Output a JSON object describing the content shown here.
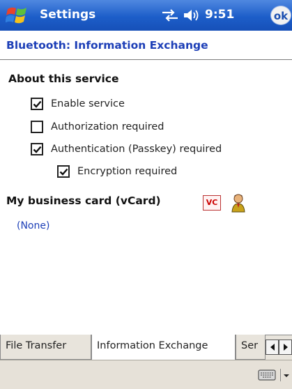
{
  "titlebar": {
    "app_title": "Settings",
    "clock": "9:51",
    "ok_label": "ok",
    "start_icon": "windows-flag-icon",
    "connectivity_icon": "connectivity-icon",
    "volume_icon": "speaker-icon"
  },
  "page": {
    "title": "Bluetooth: Information Exchange",
    "section_title": "About this service",
    "options": [
      {
        "label": "Enable service",
        "checked": true
      },
      {
        "label": "Authorization required",
        "checked": false
      },
      {
        "label": "Authentication (Passkey) required",
        "checked": true
      },
      {
        "label": "Encryption required",
        "checked": true
      }
    ],
    "vcard_title": "My business card (vCard)",
    "vcard_icon_label": "VC",
    "vcard_value": "(None)"
  },
  "tabs": [
    {
      "label": "File Transfer",
      "active": false
    },
    {
      "label": "Information Exchange",
      "active": true
    },
    {
      "label": "Ser",
      "active": false
    }
  ],
  "colors": {
    "titlebar": "#1d5ec9",
    "link_text": "#1d3fb7",
    "tab_background": "#e8e4dc"
  }
}
